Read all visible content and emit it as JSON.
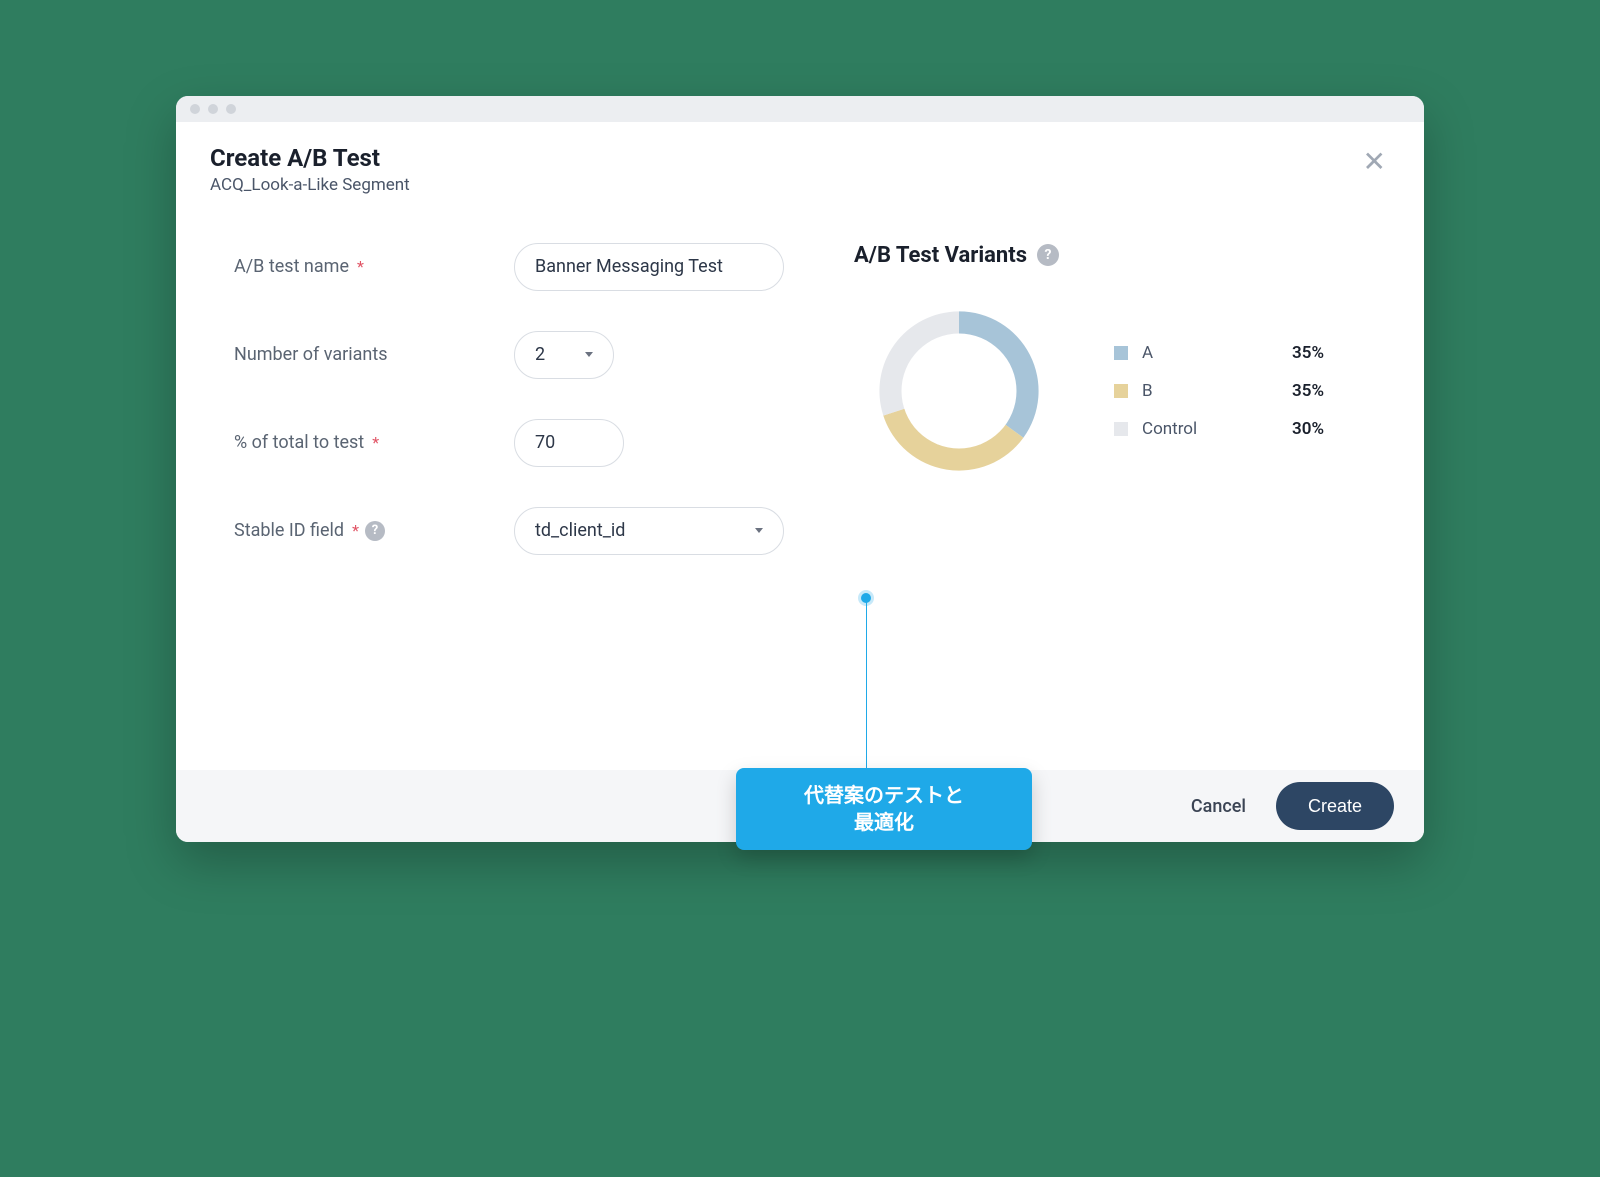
{
  "header": {
    "title": "Create A/B Test",
    "subtitle": "ACQ_Look-a-Like Segment"
  },
  "form": {
    "name": {
      "label": "A/B test name",
      "value": "Banner Messaging Test"
    },
    "variants": {
      "label": "Number of variants",
      "value": "2"
    },
    "percent": {
      "label": "% of total to test",
      "value": "70"
    },
    "stable_id": {
      "label": "Stable ID field",
      "value": "td_client_id"
    }
  },
  "right": {
    "title": "A/B Test Variants"
  },
  "footer": {
    "cancel": "Cancel",
    "create": "Create"
  },
  "annotation": {
    "line1": "代替案のテストと",
    "line2": "最適化"
  },
  "chart_data": {
    "type": "pie",
    "title": "A/B Test Variants",
    "series": [
      {
        "name": "A",
        "value": 35,
        "color": "#a7c4d8"
      },
      {
        "name": "B",
        "value": 35,
        "color": "#e6d29b"
      },
      {
        "name": "Control",
        "value": 30,
        "color": "#e6e8ec"
      }
    ]
  }
}
